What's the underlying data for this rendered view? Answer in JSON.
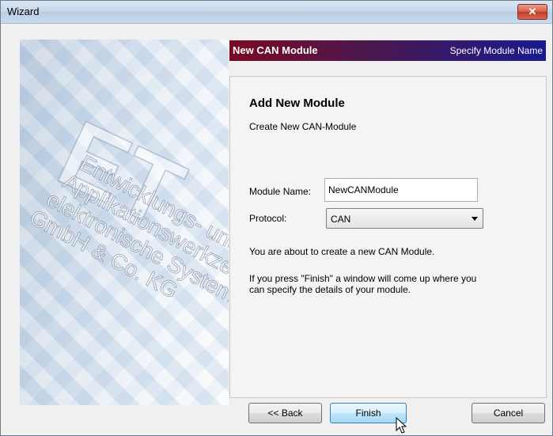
{
  "window": {
    "title": "Wizard",
    "close_glyph": "✕"
  },
  "side_image": {
    "logo_letters": "ET",
    "company_lines": [
      "Entwicklungs- und",
      "Applikationswerkzeuge für",
      "elektronische Systeme",
      "GmbH & Co. KG"
    ]
  },
  "header": {
    "title": "New CAN Module",
    "subtitle": "Specify Module Name"
  },
  "panel": {
    "heading": "Add New Module",
    "subheading": "Create New CAN-Module",
    "module_name_label": "Module Name:",
    "module_name_value": "NewCANModule",
    "protocol_label": "Protocol:",
    "protocol_value": "CAN",
    "info_line1": "You are about to create a new CAN Module.",
    "info_line2": "If you press \"Finish\" a window will come up where you can specify the details of your module."
  },
  "buttons": {
    "back": "<< Back",
    "finish": "Finish",
    "cancel": "Cancel"
  },
  "colors": {
    "header_start": "#7a0a22",
    "header_end": "#1a1a8e",
    "close_red": "#c13b26"
  }
}
